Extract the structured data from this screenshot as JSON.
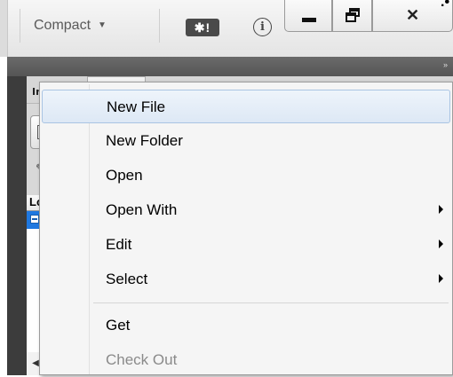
{
  "toolbar": {
    "view_mode": "Compact",
    "sync_label": "✱!",
    "info_glyph": "i",
    "close_glyph": "✕",
    "icons": [
      "dropdown-caret-icon",
      "info-icon",
      "minimize-icon",
      "restore-icon",
      "close-icon"
    ]
  },
  "panel": {
    "tab_label": "In",
    "list_header": "Lo",
    "more_glyph": "»"
  },
  "context_menu": {
    "items": [
      {
        "label": "New File",
        "submenu": false,
        "highlighted": true,
        "enabled": true
      },
      {
        "label": "New Folder",
        "submenu": false,
        "highlighted": false,
        "enabled": true
      },
      {
        "label": "Open",
        "submenu": false,
        "highlighted": false,
        "enabled": true
      },
      {
        "label": "Open With",
        "submenu": true,
        "highlighted": false,
        "enabled": true
      },
      {
        "label": "Edit",
        "submenu": true,
        "highlighted": false,
        "enabled": true
      },
      {
        "label": "Select",
        "submenu": true,
        "highlighted": false,
        "enabled": true
      },
      {
        "label": "Get",
        "submenu": false,
        "highlighted": false,
        "enabled": true
      },
      {
        "label": "Check Out",
        "submenu": false,
        "highlighted": false,
        "enabled": false
      }
    ]
  },
  "colors": {
    "highlight_border": "#a9c4e3",
    "selection_blue": "#1f78e0",
    "dark_panel": "#3c3c3c"
  }
}
